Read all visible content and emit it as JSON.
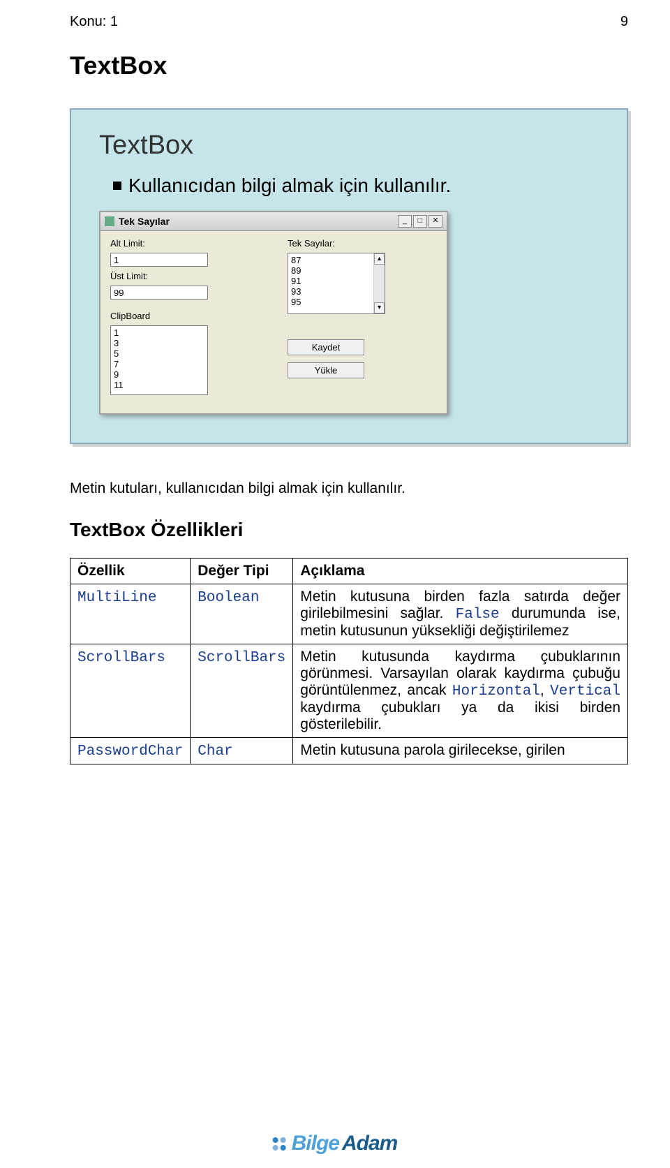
{
  "header": {
    "left": "Konu: 1",
    "right": "9"
  },
  "section_title": "TextBox",
  "slide": {
    "title": "TextBox",
    "bullet": "Kullanıcıdan bilgi almak için kullanılır."
  },
  "dialog": {
    "title": "Tek Sayılar",
    "min_btn_glyph": "_",
    "max_btn_glyph": "□",
    "close_btn_glyph": "✕",
    "labels": {
      "alt_limit": "Alt Limit:",
      "ust_limit": "Üst Limit:",
      "clipboard": "ClipBoard",
      "tek_sayilar": "Tek Sayılar:"
    },
    "values": {
      "alt_limit": "1",
      "ust_limit": "99",
      "tek_list": "87\n89\n91\n93\n95",
      "clip_list": "1\n3\n5\n7\n9\n11"
    },
    "buttons": {
      "kaydet": "Kaydet",
      "yukle": "Yükle"
    },
    "scroll_up": "▴",
    "scroll_down": "▾"
  },
  "paragraph": "Metin kutuları, kullanıcıdan bilgi almak için kullanılır.",
  "sub_heading": "TextBox Özellikleri",
  "table": {
    "headers": {
      "c1": "Özellik",
      "c2": "Değer Tipi",
      "c3": "Açıklama"
    },
    "rows": [
      {
        "c1": "MultiLine",
        "c2": "Boolean",
        "c3_pre": "Metin kutusuna birden fazla satırda değer girilebilmesini sağlar. ",
        "c3_code": "False",
        "c3_post": " durumunda ise, metin kutusunun yüksekliği değiştirilemez"
      },
      {
        "c1": "ScrollBars",
        "c2": "ScrollBars",
        "c3_pre": "Metin kutusunda kaydırma çubuklarının görünmesi. Varsayılan olarak kaydırma çubuğu görüntülenmez, ancak ",
        "c3_code": "Horizontal",
        "c3_mid": ", ",
        "c3_code2": "Vertical",
        "c3_post": " kaydırma çubukları ya da ikisi birden gösterilebilir."
      },
      {
        "c1": "PasswordChar",
        "c2": "Char",
        "c3_pre": "Metin kutusuna parola girilecekse, girilen"
      }
    ]
  },
  "footer": {
    "brand_part1": "Bilge",
    "brand_part2": "Adam"
  }
}
